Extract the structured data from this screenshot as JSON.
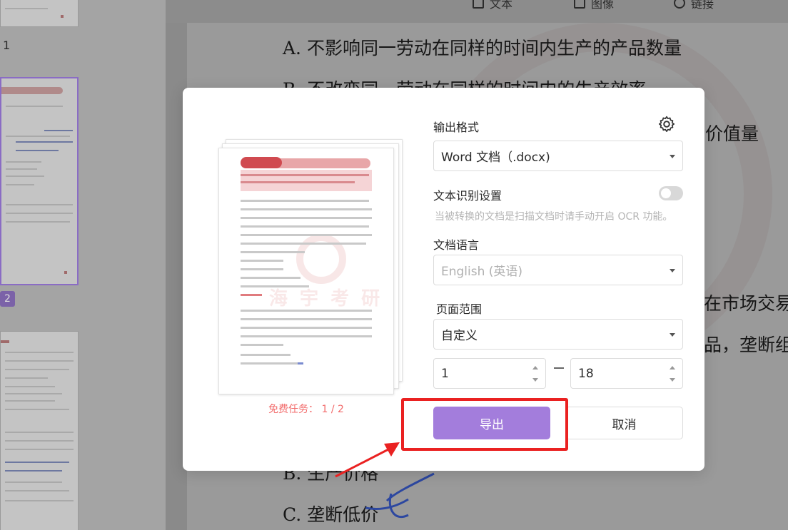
{
  "toolbar": {
    "tools": [
      {
        "label": "文本",
        "icon": "text-tool-icon"
      },
      {
        "label": "图像",
        "icon": "image-tool-icon"
      },
      {
        "label": "链接",
        "icon": "link-tool-icon"
      }
    ]
  },
  "thumbnails": {
    "page1_number": "1",
    "page2_number": "2"
  },
  "document": {
    "lines": [
      "A. 不影响同一劳动在同样的时间内生产的产品数量",
      "B. 不改变同一劳动在同样的时间内的生产效率",
      "价值量",
      "在市场交易",
      "品，垄断组",
      "B. 生产价格",
      "C. 垄断低价"
    ]
  },
  "dialog": {
    "output_format_label": "输出格式",
    "output_format_value": "Word 文档（.docx)",
    "ocr_label": "文本识别设置",
    "ocr_enabled": false,
    "ocr_hint": "当被转换的文档是扫描文档时请手动开启 OCR 功能。",
    "language_label": "文档语言",
    "language_value": "English (英语)",
    "page_range_label": "页面范围",
    "page_range_value": "自定义",
    "page_from": "1",
    "page_to": "18",
    "free_task": "免费任务： 1 / 2",
    "export_button": "导出",
    "cancel_button": "取消",
    "accent_color": "#a37ddc",
    "highlight_color": "#ea2121"
  }
}
